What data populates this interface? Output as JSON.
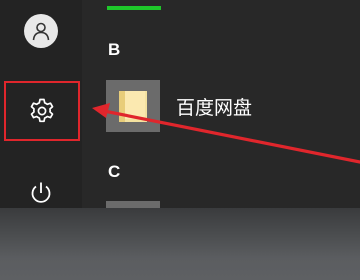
{
  "start_menu": {
    "sections": [
      {
        "letter": "B",
        "apps": [
          {
            "label": "百度网盘",
            "icon": "folder-icon"
          }
        ]
      },
      {
        "letter": "C",
        "apps": []
      }
    ],
    "rail": {
      "account_icon": "user-icon",
      "settings_icon": "gear-icon",
      "power_icon": "power-icon"
    }
  },
  "annotation": {
    "highlight_color": "#e0262c",
    "accent_color": "#1ec72a"
  }
}
